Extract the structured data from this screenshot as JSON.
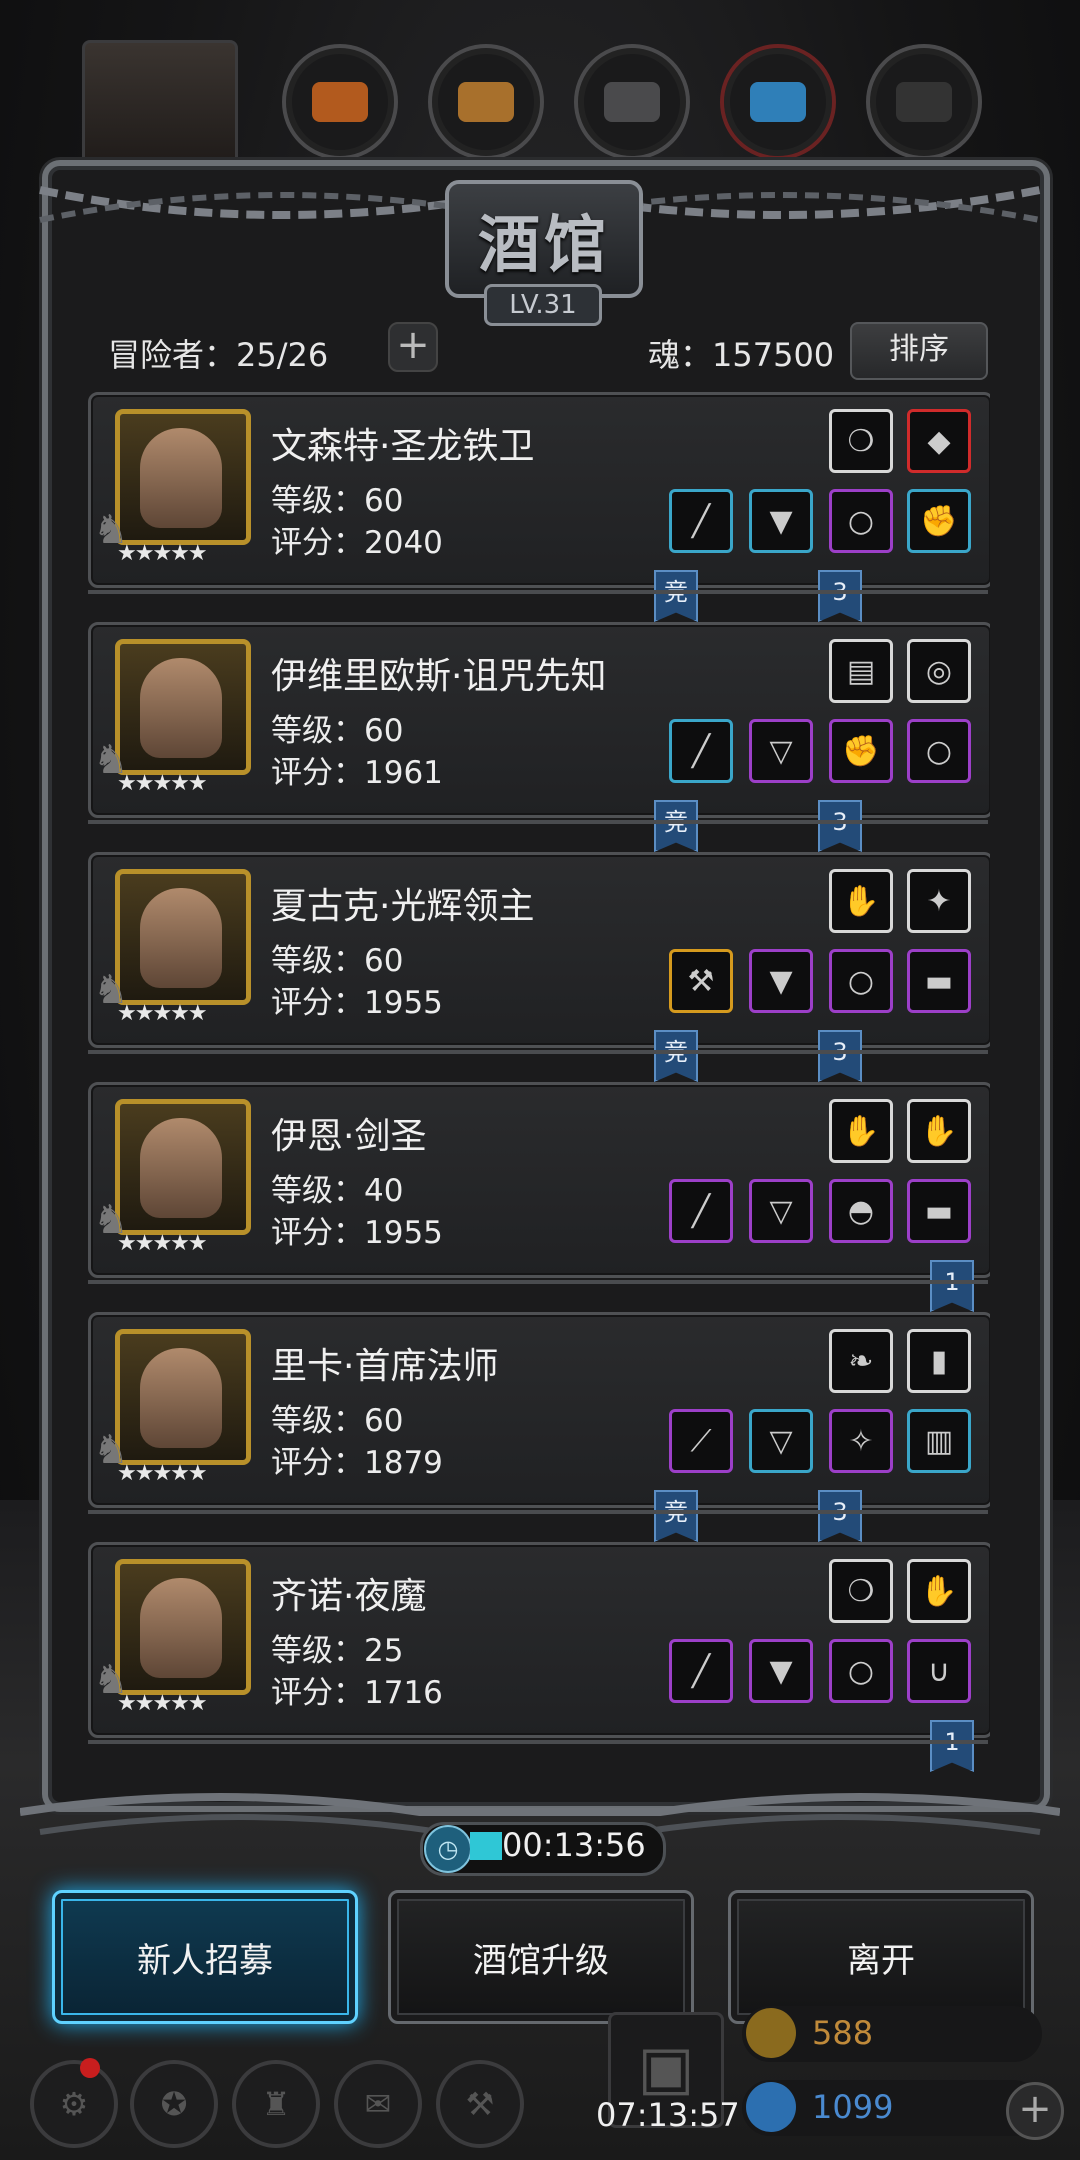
{
  "title": "酒馆",
  "level": "LV.31",
  "stats": {
    "adventurers_label": "冒险者：25/26",
    "soul_label": "魂：157500",
    "sort_label": "排序",
    "add_label": "+"
  },
  "colors": {
    "white_border": "#d8d8d8",
    "blue_border": "#3aa6c9",
    "purple_border": "#9c3fc8",
    "gold_border": "#d59a1e",
    "red_border": "#d02b2b",
    "active_button": "#5fd2ff"
  },
  "heroes": [
    {
      "name": "文森特·圣龙铁卫",
      "level": "等级：60",
      "score": "评分：2040",
      "stars": "★★★★★",
      "top_slots": [
        {
          "icon": "fang-icon",
          "rarity": "white"
        },
        {
          "icon": "ruby-gem-icon",
          "rarity": "red"
        }
      ],
      "slots": [
        {
          "icon": "greatsword-icon",
          "rarity": "blue"
        },
        {
          "icon": "chest-armor-icon",
          "rarity": "blue"
        },
        {
          "icon": "ring-icon",
          "rarity": "purple"
        },
        {
          "icon": "gauntlet-icon",
          "rarity": "blue"
        }
      ],
      "ribbons": [
        "竞",
        "3"
      ]
    },
    {
      "name": "伊维里欧斯·诅咒先知",
      "level": "等级：60",
      "score": "评分：1961",
      "stars": "★★★★★",
      "top_slots": [
        {
          "icon": "green-scroll-icon",
          "rarity": "white"
        },
        {
          "icon": "amulet-icon",
          "rarity": "white"
        }
      ],
      "slots": [
        {
          "icon": "staff-icon",
          "rarity": "blue"
        },
        {
          "icon": "leather-armor-icon",
          "rarity": "purple"
        },
        {
          "icon": "gauntlet-icon",
          "rarity": "purple"
        },
        {
          "icon": "ring-icon",
          "rarity": "purple"
        }
      ],
      "ribbons": [
        "竞",
        "3"
      ]
    },
    {
      "name": "夏古克·光辉领主",
      "level": "等级：60",
      "score": "评分：1955",
      "stars": "★★★★★",
      "top_slots": [
        {
          "icon": "empty-glove-icon",
          "rarity": "white"
        },
        {
          "icon": "crystal-icon",
          "rarity": "white"
        }
      ],
      "slots": [
        {
          "icon": "axe-icon",
          "rarity": "gold"
        },
        {
          "icon": "chest-armor-icon",
          "rarity": "purple"
        },
        {
          "icon": "ring-icon",
          "rarity": "purple"
        },
        {
          "icon": "bracer-icon",
          "rarity": "purple"
        }
      ],
      "ribbons": [
        "竞",
        "3"
      ]
    },
    {
      "name": "伊恩·剑圣",
      "level": "等级：40",
      "score": "评分：1955",
      "stars": "★★★★★",
      "top_slots": [
        {
          "icon": "empty-glove-icon",
          "rarity": "white"
        },
        {
          "icon": "empty-glove-icon",
          "rarity": "white"
        }
      ],
      "slots": [
        {
          "icon": "dagger-icon",
          "rarity": "purple"
        },
        {
          "icon": "leather-armor-icon",
          "rarity": "purple"
        },
        {
          "icon": "helmet-icon",
          "rarity": "purple"
        },
        {
          "icon": "bracer-icon",
          "rarity": "purple"
        }
      ],
      "ribbons": [
        "1"
      ]
    },
    {
      "name": "里卡·首席法师",
      "level": "等级：60",
      "score": "评分：1879",
      "stars": "★★★★★",
      "top_slots": [
        {
          "icon": "feather-icon",
          "rarity": "white"
        },
        {
          "icon": "spellbook-icon",
          "rarity": "white"
        }
      ],
      "slots": [
        {
          "icon": "wand-icon",
          "rarity": "purple"
        },
        {
          "icon": "robe-icon",
          "rarity": "blue"
        },
        {
          "icon": "amulet-chain-icon",
          "rarity": "purple"
        },
        {
          "icon": "barrel-icon",
          "rarity": "blue"
        }
      ],
      "ribbons": [
        "竞",
        "3"
      ]
    },
    {
      "name": "齐诺·夜魔",
      "level": "等级：25",
      "score": "评分：1716",
      "stars": "★★★★★",
      "top_slots": [
        {
          "icon": "fang-icon",
          "rarity": "white"
        },
        {
          "icon": "empty-glove-icon",
          "rarity": "white"
        }
      ],
      "slots": [
        {
          "icon": "dagger-icon",
          "rarity": "purple"
        },
        {
          "icon": "chest-armor-icon",
          "rarity": "purple"
        },
        {
          "icon": "ring-icon",
          "rarity": "purple"
        },
        {
          "icon": "necklace-icon",
          "rarity": "purple"
        }
      ],
      "ribbons": [
        "1"
      ]
    }
  ],
  "timer": "00:13:56",
  "buttons": {
    "recruit": "新人招募",
    "upgrade": "酒馆升级",
    "leave": "离开"
  },
  "bottom": {
    "gift_timer": "07:13:57",
    "gold": "588",
    "gems": "1099"
  }
}
